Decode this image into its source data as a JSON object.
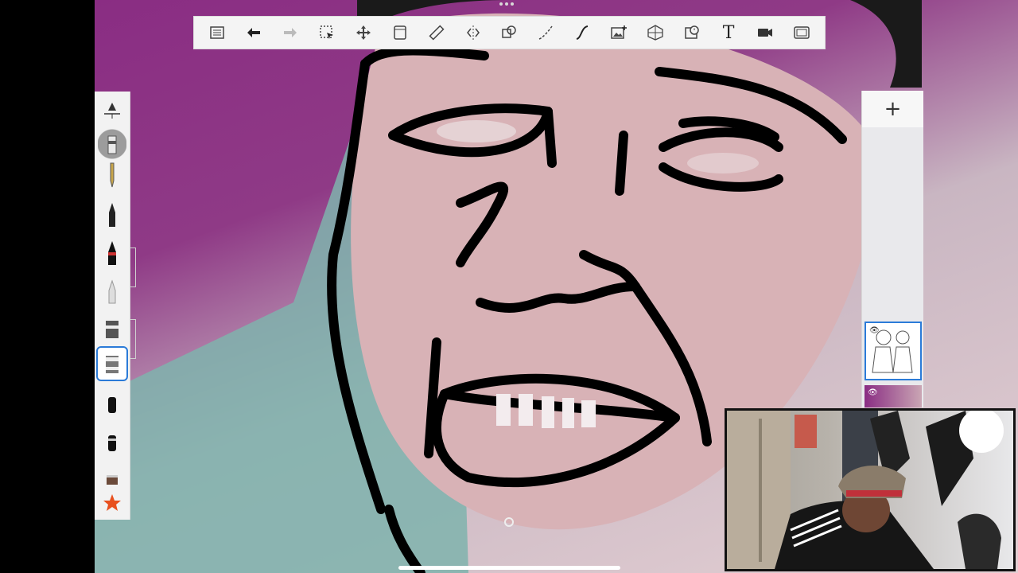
{
  "app": {
    "accent_color": "#2b7bd8",
    "toolbar_bg": "#f4f4f4"
  },
  "toolbar": {
    "tools": [
      {
        "icon": "list-icon",
        "name": "menu"
      },
      {
        "icon": "undo-icon",
        "name": "undo"
      },
      {
        "icon": "redo-icon",
        "name": "redo"
      },
      {
        "icon": "select-icon",
        "name": "selection"
      },
      {
        "icon": "move-icon",
        "name": "transform"
      },
      {
        "icon": "layer-icon",
        "name": "layers"
      },
      {
        "icon": "ruler-icon",
        "name": "ruler"
      },
      {
        "icon": "symmetry-icon",
        "name": "symmetry"
      },
      {
        "icon": "shapes-icon",
        "name": "predictive-stroke"
      },
      {
        "icon": "curve-icon",
        "name": "stroke-tool"
      },
      {
        "icon": "s-curve-icon",
        "name": "french-curve"
      },
      {
        "icon": "add-image-icon",
        "name": "import-image"
      },
      {
        "icon": "perspective-grid-icon",
        "name": "perspective"
      },
      {
        "icon": "timelapse-icon",
        "name": "time-lapse"
      },
      {
        "icon": "text-icon",
        "name": "text",
        "label": "T"
      },
      {
        "icon": "record-icon",
        "name": "record"
      },
      {
        "icon": "fullscreen-icon",
        "name": "fullscreen"
      }
    ]
  },
  "brushes": [
    {
      "icon": "brush-size-slider-icon"
    },
    {
      "icon": "pencil-brush-icon"
    },
    {
      "icon": "pencil-tip-icon"
    },
    {
      "icon": "ink-pen-icon"
    },
    {
      "icon": "marker-icon"
    },
    {
      "icon": "airbrush-icon"
    },
    {
      "icon": "paint-brush-icon"
    },
    {
      "icon": "felt-tip-icon"
    },
    {
      "icon": "chisel-marker-icon"
    },
    {
      "icon": "blender-icon"
    },
    {
      "icon": "eraser-block-icon"
    },
    {
      "icon": "star-icon"
    }
  ],
  "layers": {
    "add_label": "+",
    "items": [
      {
        "icon": "eye-icon",
        "visible": true,
        "selected": true
      },
      {
        "icon": "eye-icon",
        "visible": true,
        "selected": false
      }
    ]
  }
}
